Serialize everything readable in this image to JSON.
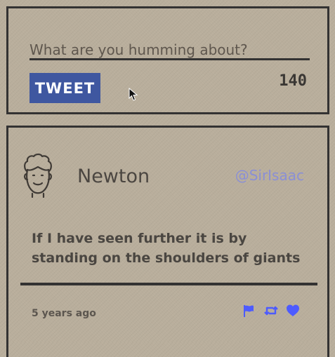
{
  "composer": {
    "placeholder": "What are you humming about?",
    "value": "",
    "tweet_button_label": "TWEET",
    "char_count": "140"
  },
  "tweet": {
    "author_name": "Newton",
    "author_handle": "@SirIsaac",
    "text": "If I have seen further it is by standing on the shoulders of giants",
    "timestamp": "5 years ago",
    "actions": [
      "flag-icon",
      "retweet-icon",
      "heart-icon"
    ]
  },
  "colors": {
    "background": "#b9ae9c",
    "border": "#333232",
    "tweet_button": "#3f57a0",
    "handle": "#8a8fd6",
    "action_icons": "#4d5bff"
  }
}
